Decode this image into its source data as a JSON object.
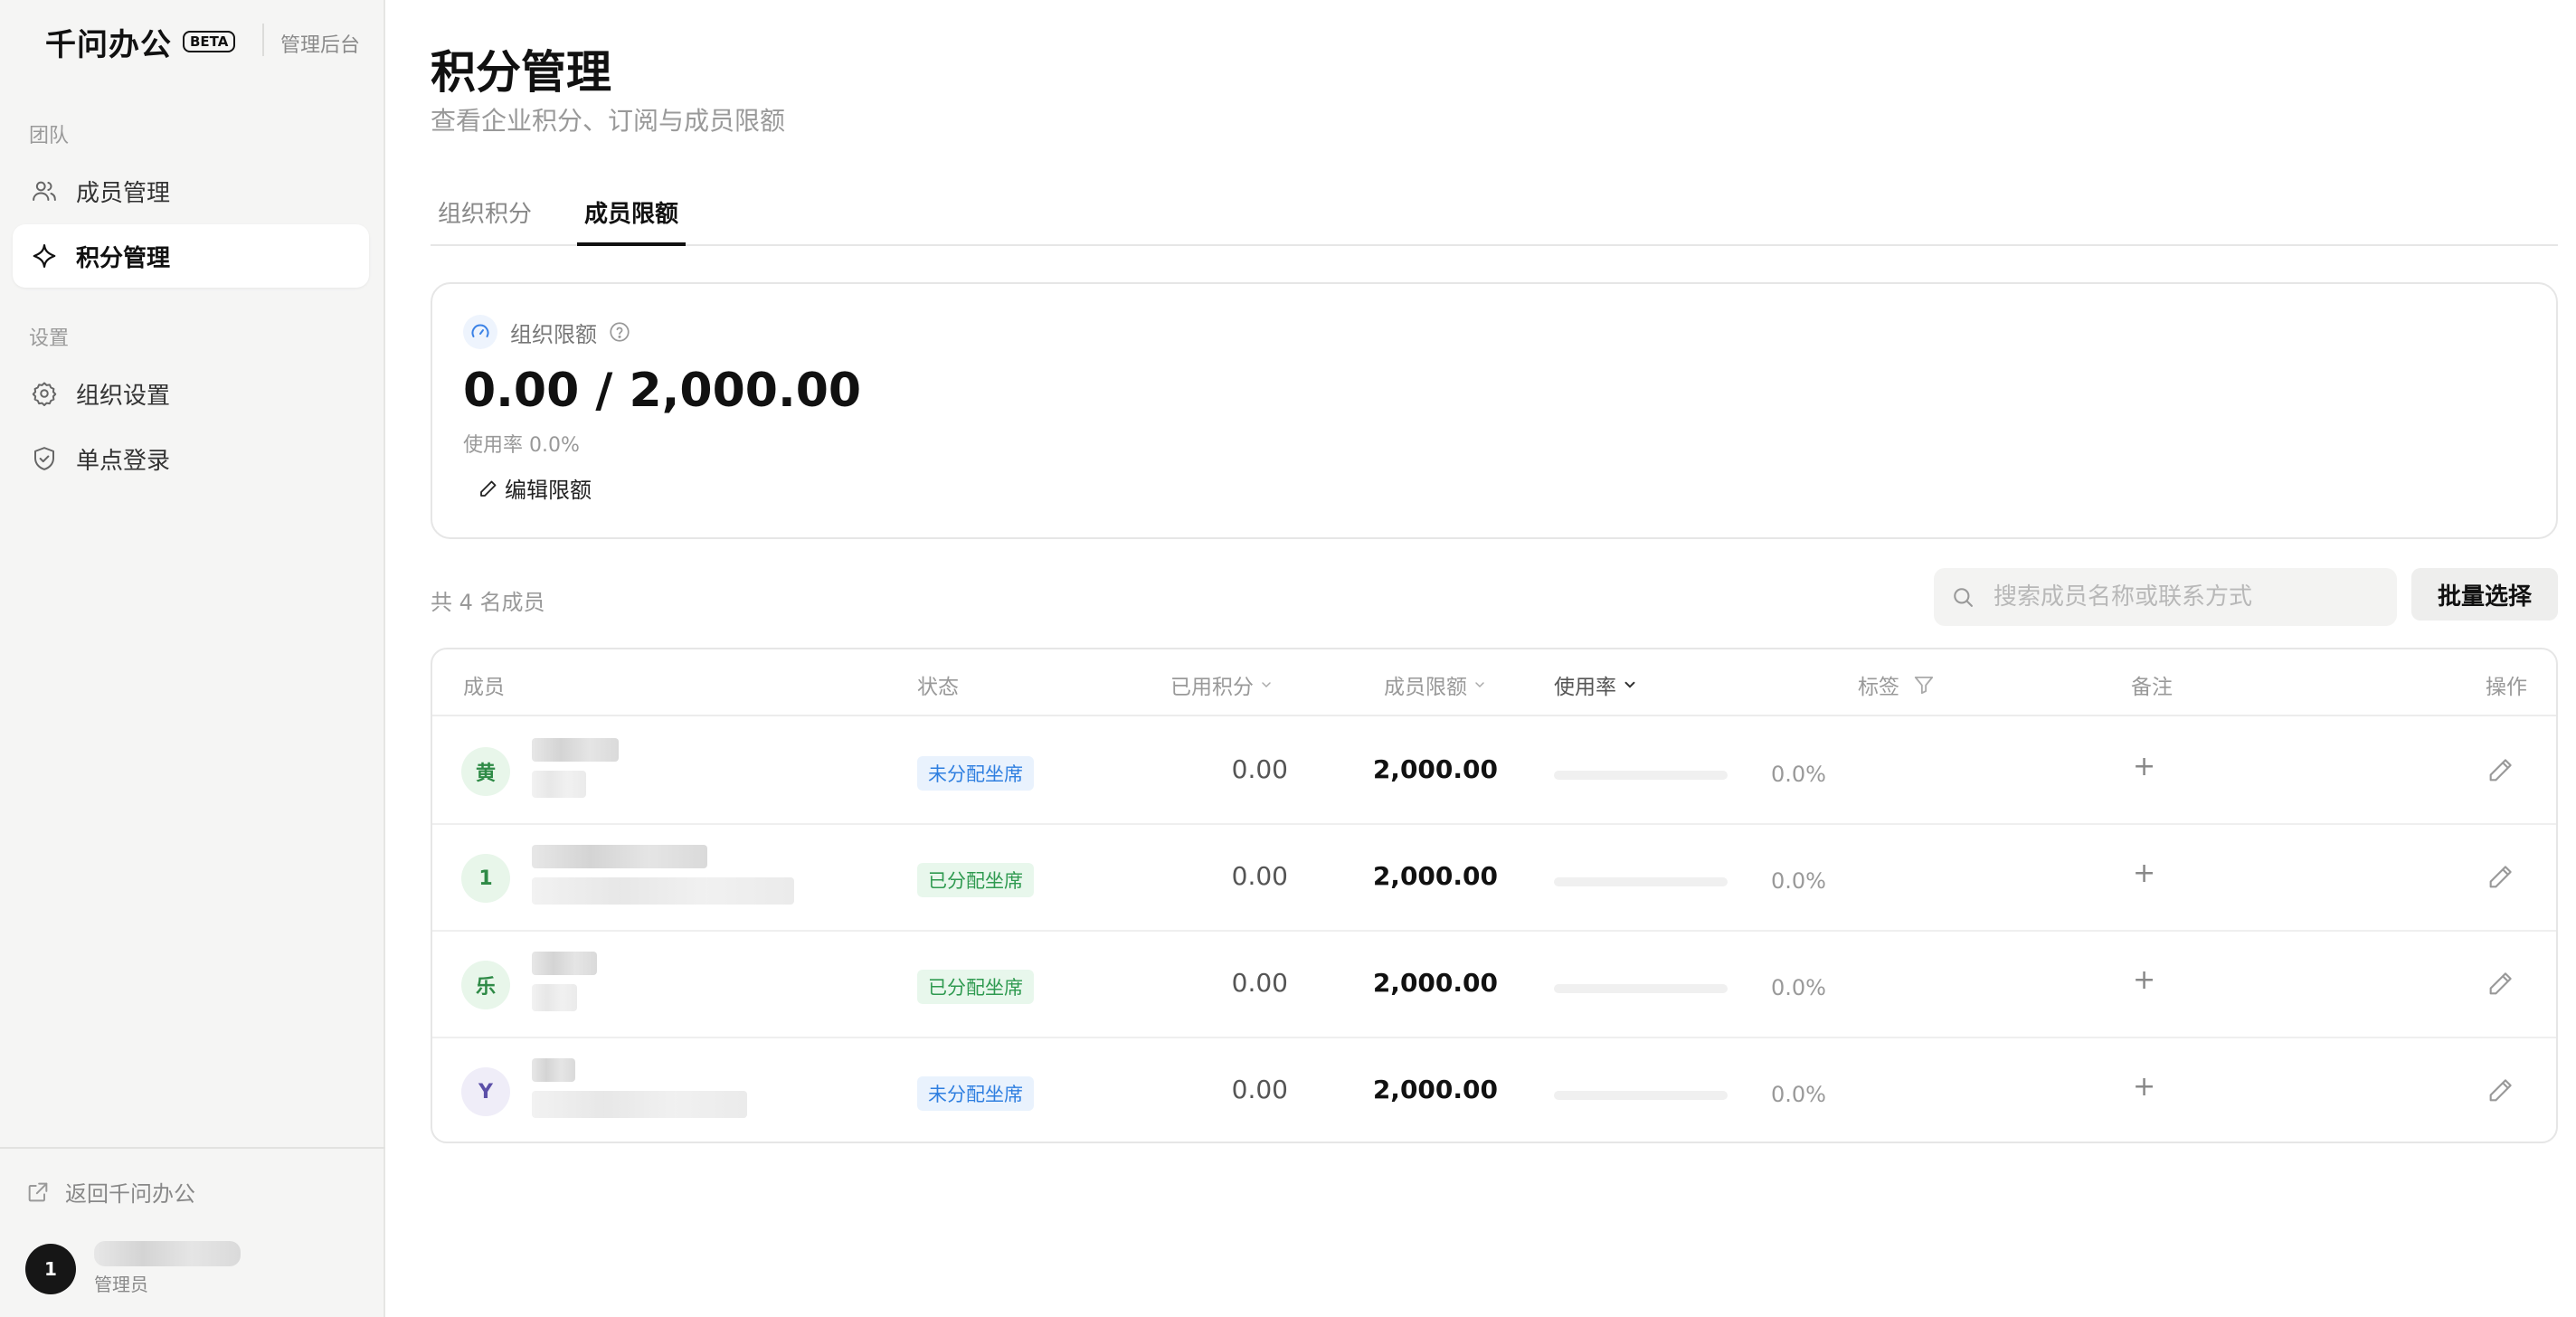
{
  "brand": {
    "name": "千问办公",
    "beta": "BETA",
    "admin_label": "管理后台"
  },
  "sidebar": {
    "groups": [
      {
        "label": "团队",
        "items": [
          {
            "label": "成员管理",
            "icon": "users-icon",
            "active": false
          },
          {
            "label": "积分管理",
            "icon": "sparkle-icon",
            "active": true
          }
        ]
      },
      {
        "label": "设置",
        "items": [
          {
            "label": "组织设置",
            "icon": "gear-icon",
            "active": false
          },
          {
            "label": "单点登录",
            "icon": "shield-check-icon",
            "active": false
          }
        ]
      }
    ],
    "back_link": "返回千问办公",
    "user": {
      "avatar_text": "1",
      "role": "管理员"
    }
  },
  "page": {
    "title": "积分管理",
    "subtitle": "查看企业积分、订阅与成员限额"
  },
  "tabs": [
    {
      "label": "组织积分",
      "active": false
    },
    {
      "label": "成员限额",
      "active": true
    }
  ],
  "quota_card": {
    "label": "组织限额",
    "value": "0.00 / 2,000.00",
    "usage": "使用率 0.0%",
    "edit_label": "编辑限额"
  },
  "toolbar": {
    "member_count": "共 4 名成员",
    "search_placeholder": "搜索成员名称或联系方式",
    "bulk_select": "批量选择"
  },
  "table": {
    "columns": {
      "member": "成员",
      "status": "状态",
      "used": "已用积分",
      "limit": "成员限额",
      "rate": "使用率",
      "tags": "标签",
      "notes": "备注",
      "actions": "操作"
    },
    "add_symbol": "+",
    "rows": [
      {
        "avatar": "黄",
        "avatar_color": "green",
        "status": "未分配坐席",
        "status_color": "blue",
        "used": "0.00",
        "limit": "2,000.00",
        "rate": "0.0%",
        "rate_value": 0.0
      },
      {
        "avatar": "1",
        "avatar_color": "green",
        "status": "已分配坐席",
        "status_color": "green",
        "used": "0.00",
        "limit": "2,000.00",
        "rate": "0.0%",
        "rate_value": 0.0
      },
      {
        "avatar": "乐",
        "avatar_color": "green",
        "status": "已分配坐席",
        "status_color": "green",
        "used": "0.00",
        "limit": "2,000.00",
        "rate": "0.0%",
        "rate_value": 0.0
      },
      {
        "avatar": "Y",
        "avatar_color": "purple",
        "status": "未分配坐席",
        "status_color": "blue",
        "used": "0.00",
        "limit": "2,000.00",
        "rate": "0.0%",
        "rate_value": 0.0
      }
    ]
  },
  "colors": {
    "accent_blue": "#2f7fe0",
    "success_green": "#2f9a50",
    "text_primary": "#111111"
  }
}
